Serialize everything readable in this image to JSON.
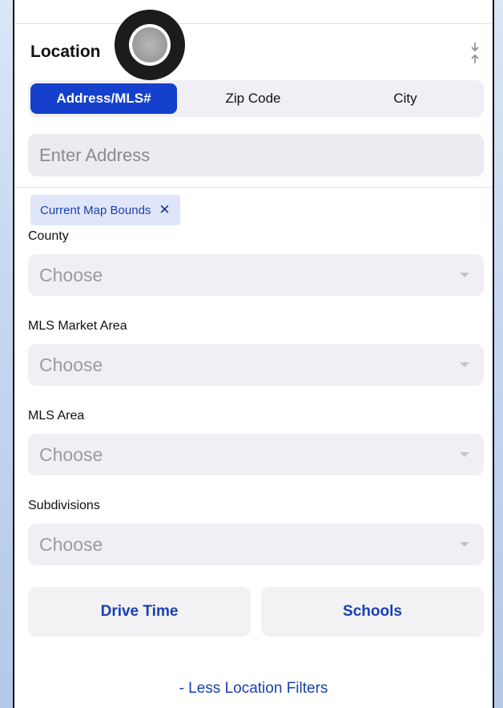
{
  "location": {
    "title": "Location",
    "tabs": [
      {
        "label": "Address/MLS#",
        "active": true
      },
      {
        "label": "Zip Code",
        "active": false
      },
      {
        "label": "City",
        "active": false
      }
    ],
    "address_placeholder": "Enter Address"
  },
  "chip": {
    "label": "Current Map Bounds",
    "remove": "✕"
  },
  "fields": [
    {
      "label": "County",
      "value": "Choose"
    },
    {
      "label": "MLS Market Area",
      "value": "Choose"
    },
    {
      "label": "MLS Area",
      "value": "Choose"
    },
    {
      "label": "Subdivisions",
      "value": "Choose"
    }
  ],
  "buttons": {
    "drive_time": "Drive Time",
    "schools": "Schools"
  },
  "less_filters": "- Less Location Filters",
  "colors": {
    "accent": "#1440cc",
    "link": "#1a3fb0",
    "chip_bg": "#e0e6f9"
  },
  "icons": {
    "collapse": "collapse-arrows-icon",
    "remove_chip": "close-icon",
    "dropdown": "chevron-down-icon"
  }
}
